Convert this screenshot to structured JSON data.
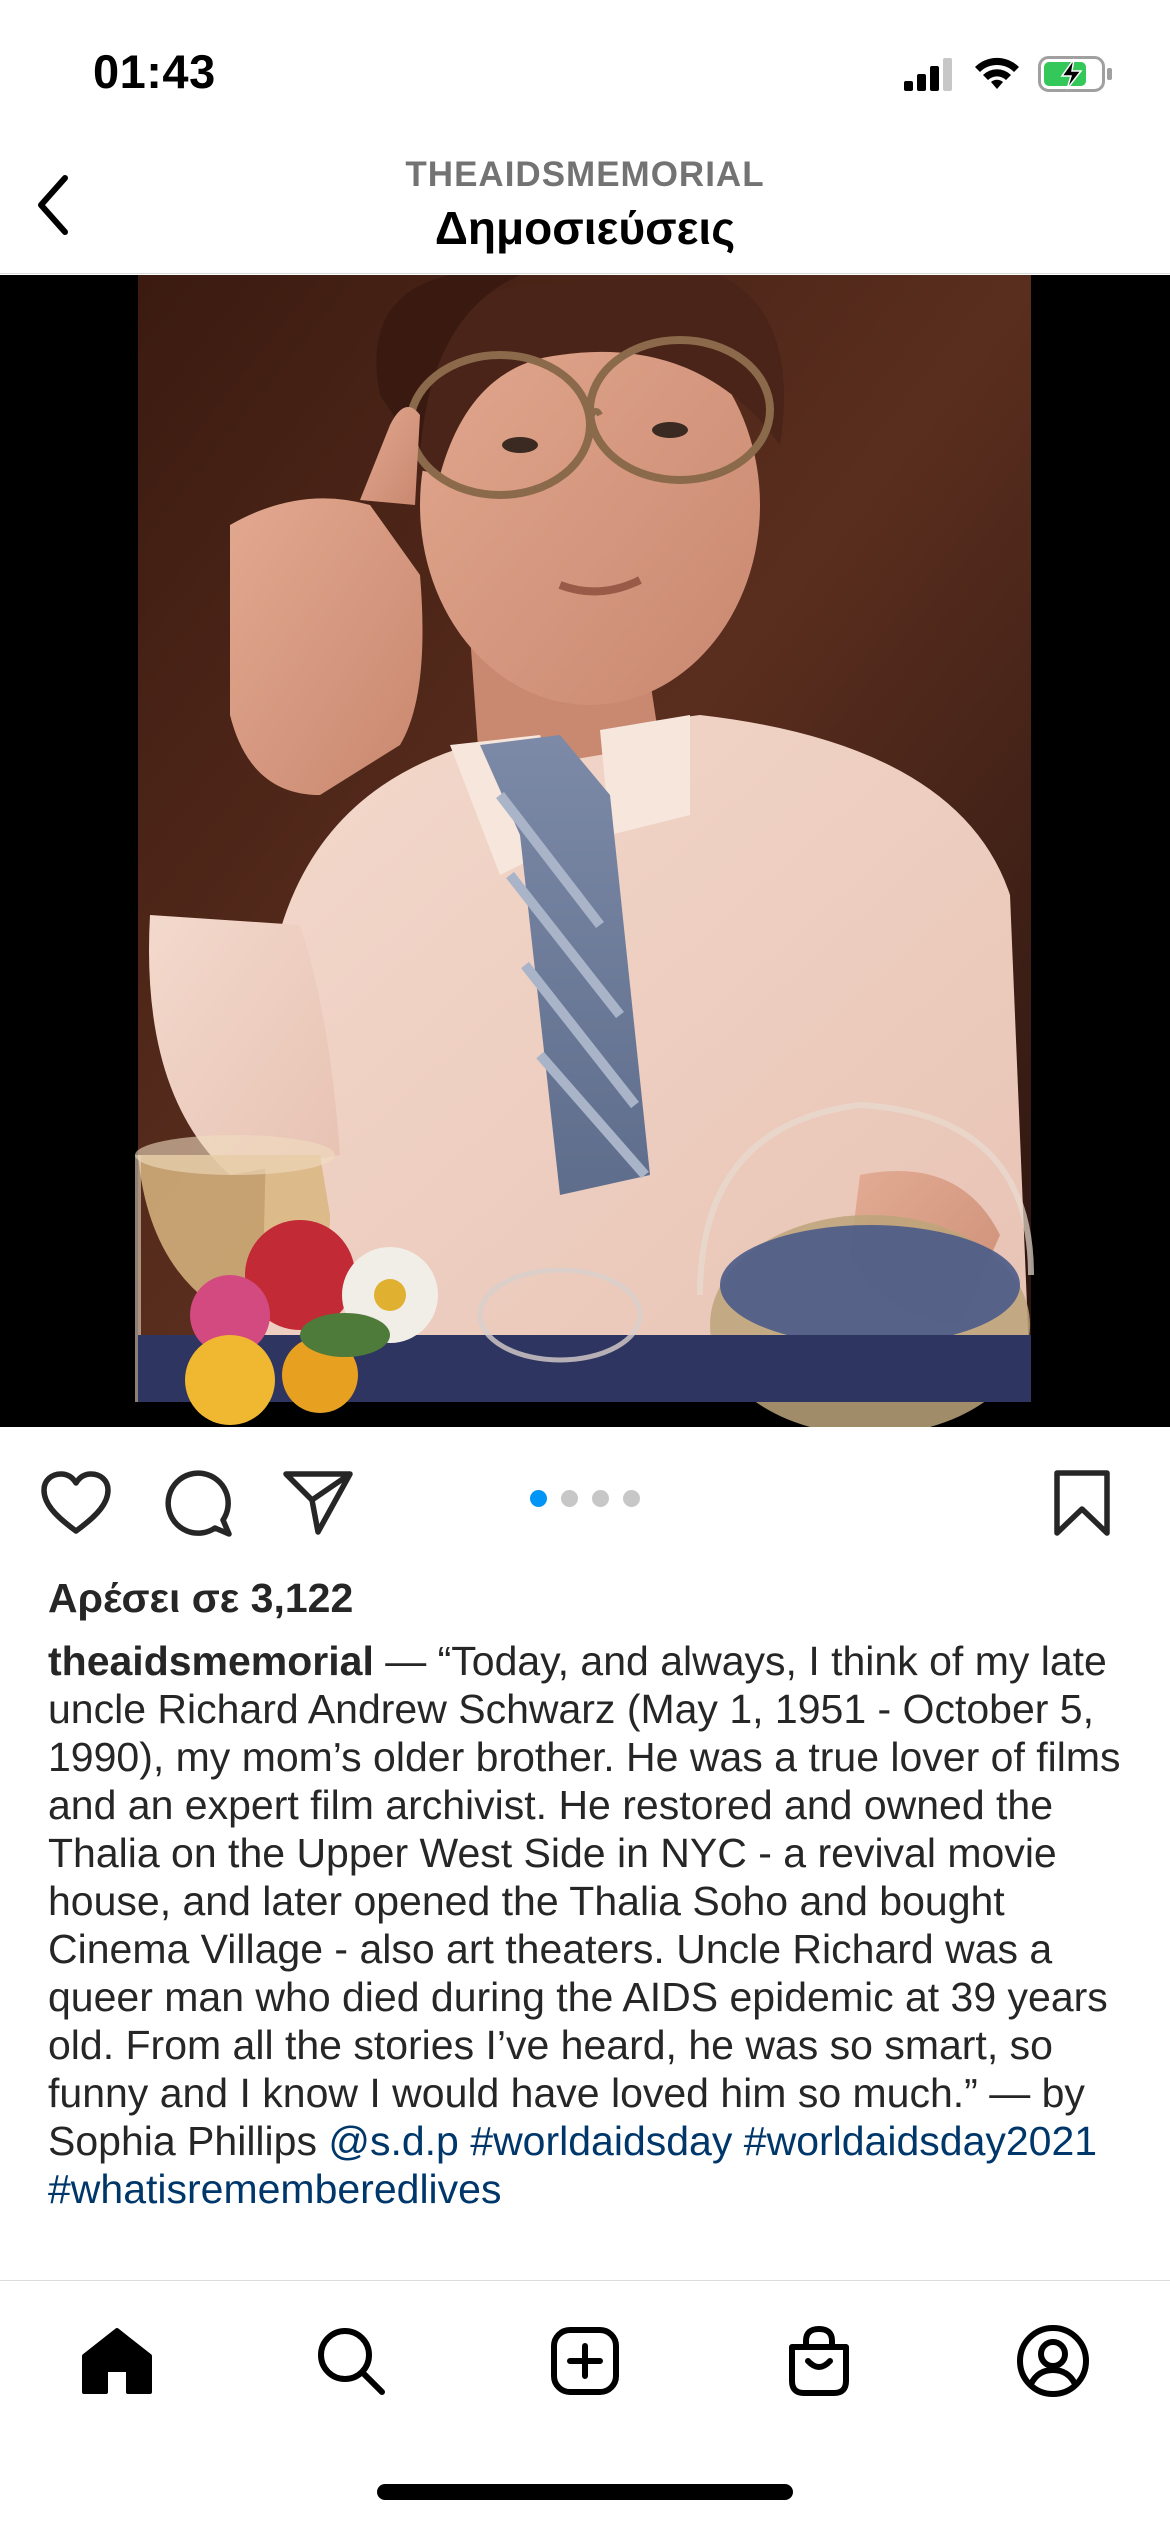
{
  "status_bar": {
    "time": "01:43",
    "icons": [
      "cellular-signal-icon",
      "wifi-icon",
      "battery-charging-icon"
    ]
  },
  "header": {
    "account": "THEAIDSMEMORIAL",
    "title": "Δημοσιεύσεις",
    "back_icon": "chevron-left-icon"
  },
  "post": {
    "photo_alt": "",
    "carousel": {
      "count": 4,
      "active": 1
    },
    "actions": [
      "like-heart-icon",
      "comment-bubble-icon",
      "share-send-icon",
      "save-bookmark-icon"
    ],
    "likes": "Αρέσει σε 3,122",
    "caption": {
      "username": "theaidsmemorial",
      "text": " — “Today, and always, I think of my late uncle Richard Andrew Schwarz (May 1, 1951 - October 5, 1990), my mom’s older brother.  He was a true lover of films and an expert film archivist.  He restored and owned the Thalia on the Upper West Side in NYC - a revival movie house, and later opened the Thalia Soho and bought Cinema Village - also art theaters.  Uncle Richard was a queer man who died during the AIDS epidemic at 39 years old.  From all the stories I’ve heard, he was so smart, so funny and I know I would have loved him so much.” — by Sophia Phillips ",
      "mention": "@s.d.p",
      "hashtag1": "#worldaidsday",
      "hashtag2": "#worldaidsday2021",
      "hashtag3": "#whatisrememberedlives"
    }
  },
  "tab_bar": {
    "items": [
      "home-icon",
      "search-icon",
      "new-post-icon",
      "shop-bag-icon",
      "profile-icon"
    ],
    "active": "home-icon"
  },
  "colors": {
    "link": "#00376b",
    "carousel_active": "#0095f6",
    "battery": "#34c759"
  }
}
